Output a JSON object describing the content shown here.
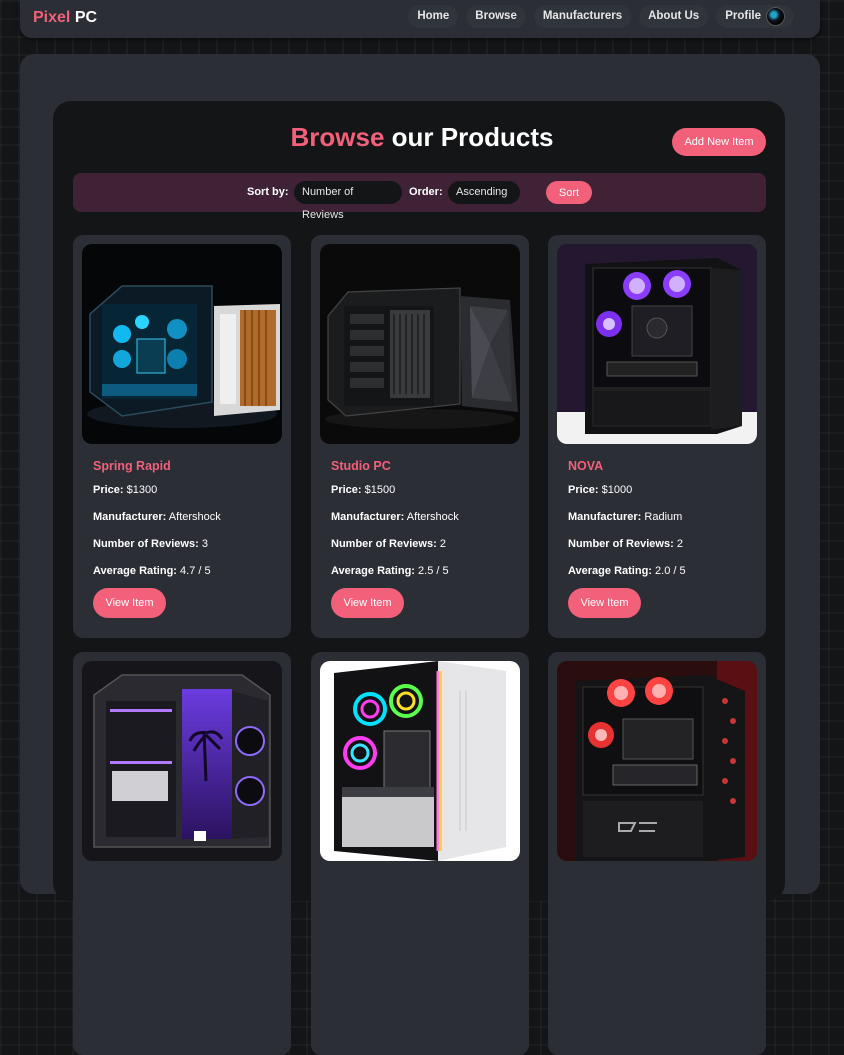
{
  "nav": {
    "brand_first": "Pixel",
    "brand_second": "PC",
    "links": [
      "Home",
      "Browse",
      "Manufacturers",
      "About Us"
    ],
    "profile_label": "Profile"
  },
  "header": {
    "title_highlight": "Browse",
    "title_rest": "our Products",
    "add_button": "Add New Item"
  },
  "sort": {
    "sort_by_label": "Sort by:",
    "sort_by_value": "Number of Reviews",
    "order_label": "Order:",
    "order_value": "Ascending",
    "sort_button": "Sort"
  },
  "labels": {
    "price": "Price:",
    "manufacturer": "Manufacturer:",
    "reviews": "Number of Reviews:",
    "rating": "Average Rating:",
    "view_button": "View Item"
  },
  "products": [
    {
      "name": "Spring Rapid",
      "price": "$1300",
      "manufacturer": "Aftershock",
      "reviews": "3",
      "rating": "4.7 / 5"
    },
    {
      "name": "Studio PC",
      "price": "$1500",
      "manufacturer": "Aftershock",
      "reviews": "2",
      "rating": "2.5 / 5"
    },
    {
      "name": "NOVA",
      "price": "$1000",
      "manufacturer": "Radium",
      "reviews": "2",
      "rating": "2.0 / 5"
    },
    {
      "name": "",
      "price": "",
      "manufacturer": "",
      "reviews": "",
      "rating": ""
    },
    {
      "name": "",
      "price": "",
      "manufacturer": "",
      "reviews": "",
      "rating": ""
    },
    {
      "name": "",
      "price": "",
      "manufacturer": "",
      "reviews": "",
      "rating": ""
    }
  ],
  "colors": {
    "accent": "#f2607a",
    "panel": "#2b2e35",
    "sortbar": "#3f2236",
    "background": "#141517"
  }
}
